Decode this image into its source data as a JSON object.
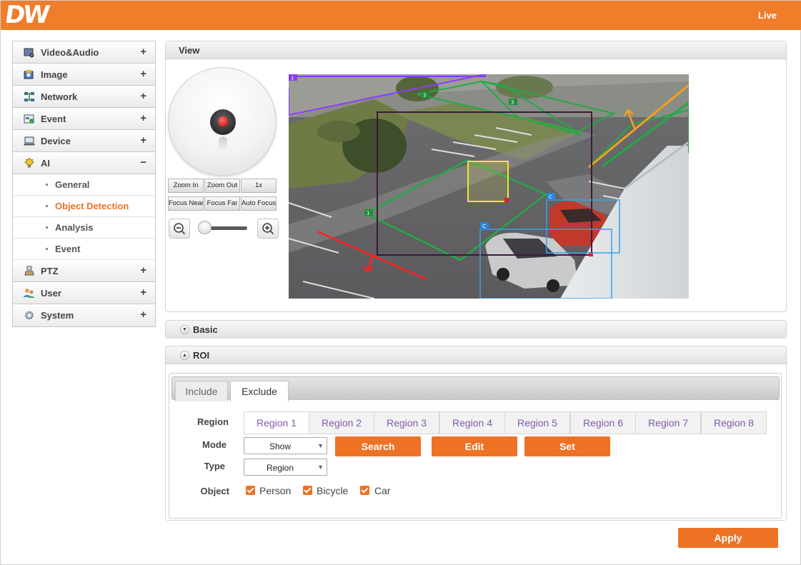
{
  "header": {
    "logo": "DW",
    "live": "Live"
  },
  "sidebar": {
    "items": [
      {
        "label": "Video&Audio",
        "sign": "+"
      },
      {
        "label": "Image",
        "sign": "+"
      },
      {
        "label": "Network",
        "sign": "+"
      },
      {
        "label": "Event",
        "sign": "+"
      },
      {
        "label": "Device",
        "sign": "+"
      },
      {
        "label": "AI",
        "sign": "−"
      },
      {
        "label": "PTZ",
        "sign": "+"
      },
      {
        "label": "User",
        "sign": "+"
      },
      {
        "label": "System",
        "sign": "+"
      }
    ],
    "ai_sub": [
      {
        "label": "General"
      },
      {
        "label": "Object Detection"
      },
      {
        "label": "Analysis"
      },
      {
        "label": "Event"
      }
    ]
  },
  "view": {
    "title": "View",
    "buttons": {
      "zoom_in": "Zoom In",
      "zoom_out": "Zoom Out",
      "ratio": "1x",
      "focus_near": "Focus Near",
      "focus_far": "Focus Far",
      "auto_focus": "Auto Focus"
    },
    "overlay_labels": {
      "purple": "1",
      "green_a": "3",
      "green_b": "3",
      "green_c": "1",
      "blue_a": "C",
      "blue_b": "C"
    },
    "zoom_slider_level": 0.05
  },
  "basic": {
    "title": "Basic"
  },
  "roi": {
    "title": "ROI",
    "tabs": [
      "Include",
      "Exclude"
    ],
    "region_label": "Region",
    "regions": [
      "Region 1",
      "Region 2",
      "Region 3",
      "Region 4",
      "Region 5",
      "Region 6",
      "Region 7",
      "Region 8"
    ],
    "mode_label": "Mode",
    "mode_value": "Show",
    "type_label": "Type",
    "type_value": "Region",
    "object_label": "Object",
    "objects": [
      {
        "label": "Person",
        "checked": true
      },
      {
        "label": "Bicycle",
        "checked": true
      },
      {
        "label": "Car",
        "checked": true
      }
    ],
    "buttons": {
      "search": "Search",
      "edit": "Edit",
      "set": "Set"
    }
  },
  "apply_label": "Apply",
  "colors": {
    "accent": "#ed7224",
    "header": "#ef7d2a",
    "active_text": "#e8732a",
    "region_text": "#7f5bb0"
  }
}
